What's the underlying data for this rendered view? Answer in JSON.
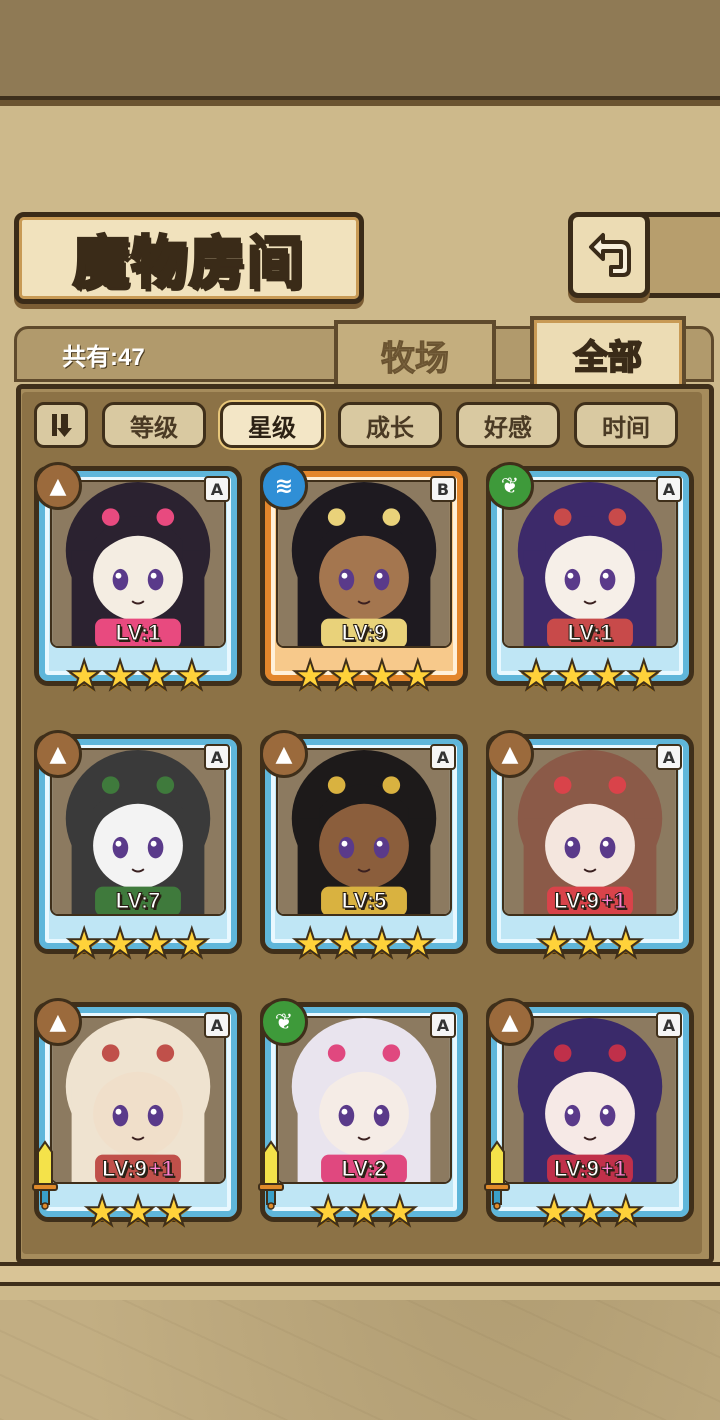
{
  "header": {
    "title": "魔物房间",
    "back_icon": "return-arrow-icon"
  },
  "summary": {
    "count_label": "共有:47"
  },
  "tabs": [
    {
      "label": "牧场",
      "active": false
    },
    {
      "label": "全部",
      "active": true
    }
  ],
  "sort": {
    "toggle_icon": "sort-order-icon",
    "buttons": [
      {
        "label": "等级",
        "active": false
      },
      {
        "label": "星级",
        "active": true
      },
      {
        "label": "成长",
        "active": false
      },
      {
        "label": "好感",
        "active": false
      },
      {
        "label": "时间",
        "active": false
      }
    ]
  },
  "monsters": [
    {
      "element": "earth",
      "rank": "A",
      "level": "LV:1",
      "plus": "",
      "stars": 4,
      "frame": "blue",
      "sword": false,
      "palette": [
        "#f4ede2",
        "#2b2230",
        "#e84a7f"
      ]
    },
    {
      "element": "water",
      "rank": "B",
      "level": "LV:9",
      "plus": "",
      "stars": 4,
      "frame": "orange",
      "sword": false,
      "palette": [
        "#a4764f",
        "#1e1a20",
        "#e9d27a"
      ]
    },
    {
      "element": "wood",
      "rank": "A",
      "level": "LV:1",
      "plus": "",
      "stars": 4,
      "frame": "blue",
      "sword": false,
      "palette": [
        "#f6efe8",
        "#3d2a6a",
        "#c84a4a"
      ]
    },
    {
      "element": "earth",
      "rank": "A",
      "level": "LV:7",
      "plus": "",
      "stars": 4,
      "frame": "blue",
      "sword": false,
      "palette": [
        "#f3f3f3",
        "#3a3a3a",
        "#3f7a3c"
      ]
    },
    {
      "element": "earth",
      "rank": "A",
      "level": "LV:5",
      "plus": "",
      "stars": 4,
      "frame": "blue",
      "sword": false,
      "palette": [
        "#8b5e3c",
        "#1d1a1a",
        "#d9b240"
      ]
    },
    {
      "element": "earth",
      "rank": "A",
      "level": "LV:9",
      "plus": "+1",
      "stars": 3,
      "frame": "blue",
      "sword": false,
      "palette": [
        "#f4e6de",
        "#8b5a48",
        "#d9434a"
      ]
    },
    {
      "element": "earth",
      "rank": "A",
      "level": "LV:9",
      "plus": "+1",
      "stars": 3,
      "frame": "blue",
      "sword": true,
      "palette": [
        "#f0dfca",
        "#efe3d0",
        "#c0504a"
      ]
    },
    {
      "element": "wood",
      "rank": "A",
      "level": "LV:2",
      "plus": "",
      "stars": 3,
      "frame": "blue",
      "sword": true,
      "palette": [
        "#f5ece6",
        "#e9e4ee",
        "#e0487f"
      ]
    },
    {
      "element": "earth",
      "rank": "A",
      "level": "LV:9",
      "plus": "+1",
      "stars": 3,
      "frame": "blue",
      "sword": true,
      "palette": [
        "#f6e9e6",
        "#3a2a6a",
        "#c0304a"
      ]
    }
  ]
}
